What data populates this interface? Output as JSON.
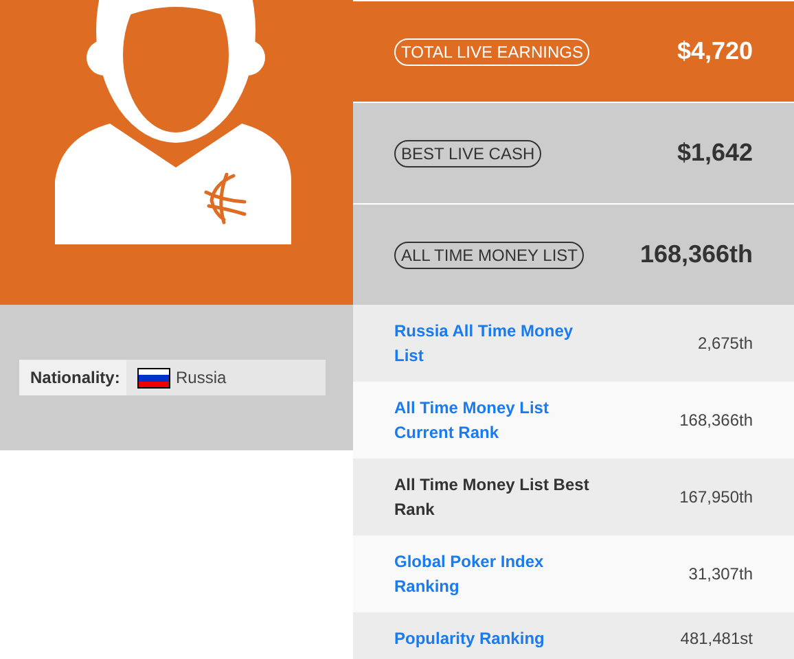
{
  "profile": {
    "nationality_label": "Nationality:",
    "nationality": "Russia"
  },
  "stats": [
    {
      "label": "TOTAL LIVE EARNINGS",
      "value": "$4,720",
      "highlighted": true
    },
    {
      "label": "BEST LIVE CASH",
      "value": "$1,642",
      "highlighted": false
    },
    {
      "label": "ALL TIME MONEY LIST",
      "value": "168,366th",
      "highlighted": false
    }
  ],
  "rankings": [
    {
      "label": "Russia All Time Money List",
      "value": "2,675th",
      "kind": "link"
    },
    {
      "label": "All Time Money List Current Rank",
      "value": "168,366th",
      "kind": "link"
    },
    {
      "label": "All Time Money List Best Rank",
      "value": "167,950th",
      "kind": "text"
    },
    {
      "label": "Global Poker Index Ranking",
      "value": "31,307th",
      "kind": "link"
    },
    {
      "label": "Popularity Ranking",
      "value": "481,481st",
      "kind": "link"
    }
  ]
}
